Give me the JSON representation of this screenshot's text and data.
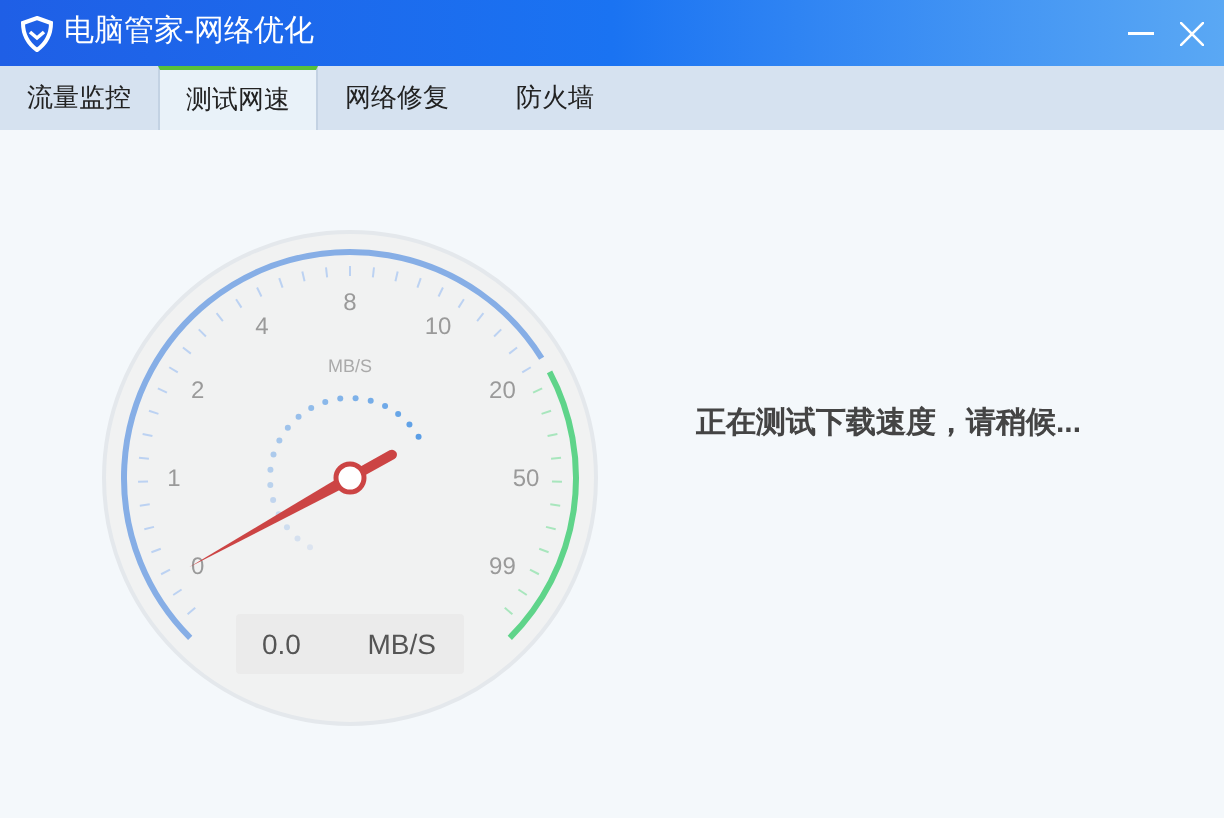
{
  "window": {
    "title": "电脑管家-网络优化"
  },
  "tabs": [
    {
      "label": "流量监控",
      "selected": false
    },
    {
      "label": "测试网速",
      "selected": true
    },
    {
      "label": "网络修复",
      "selected": false
    },
    {
      "label": "防火墙",
      "selected": false
    }
  ],
  "gauge": {
    "unit": "MB/S",
    "scale": [
      "0",
      "1",
      "2",
      "4",
      "8",
      "10",
      "20",
      "50",
      "99"
    ],
    "reading": "0.0",
    "reading_unit": "MB/S"
  },
  "status_text": "正在测试下载速度，请稍候..."
}
